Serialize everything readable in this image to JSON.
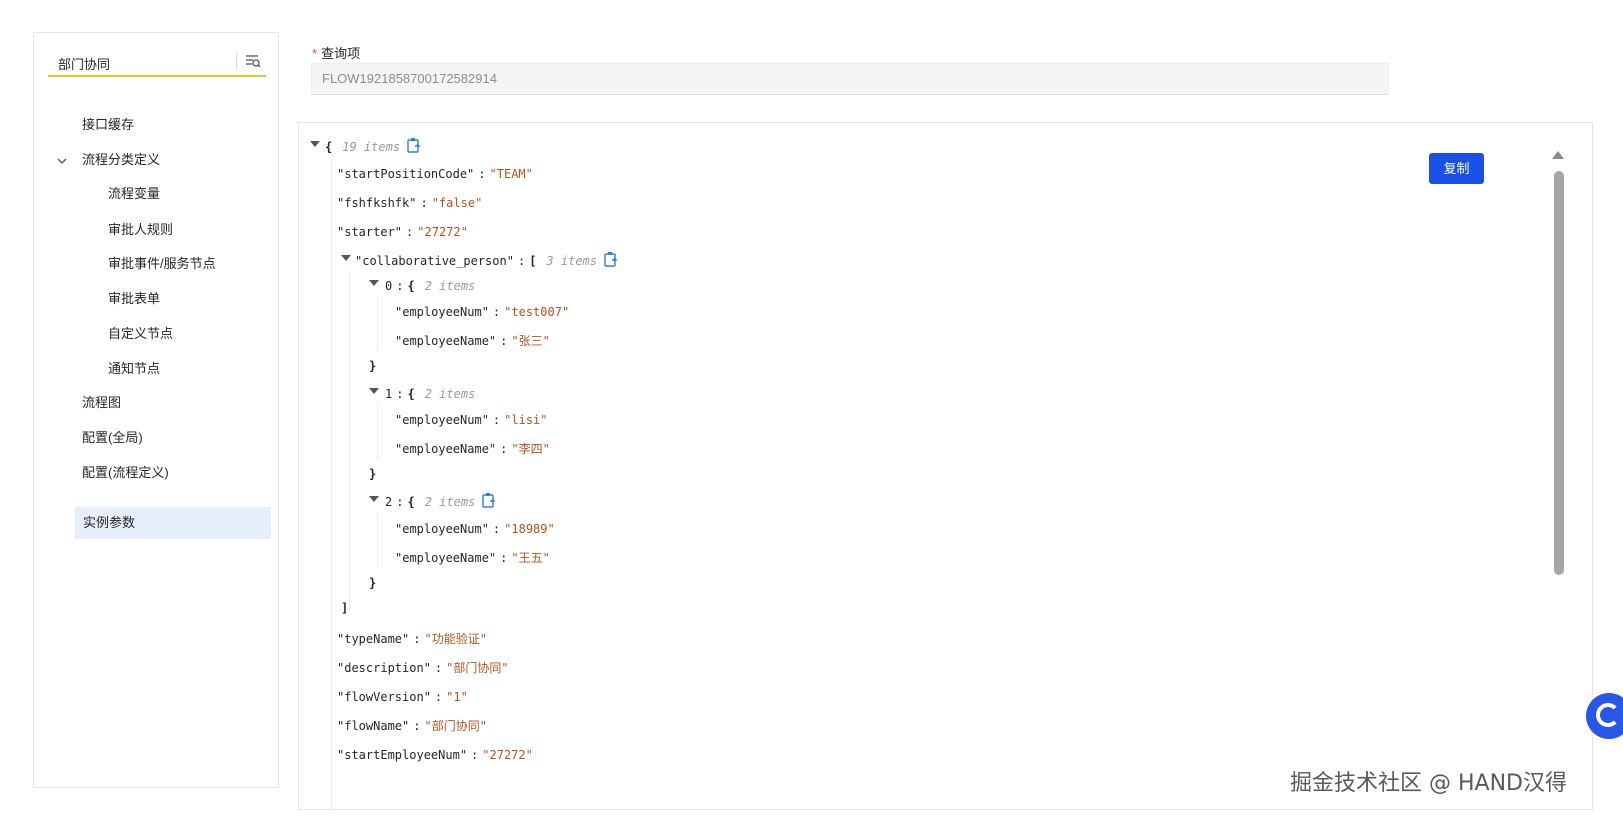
{
  "sidebar": {
    "search_value": "部门协同",
    "items": [
      {
        "label": "接口缓存"
      },
      {
        "label": "流程分类定义"
      },
      {
        "label": "流程变量"
      },
      {
        "label": "审批人规则"
      },
      {
        "label": "审批事件/服务节点"
      },
      {
        "label": "审批表单"
      },
      {
        "label": "自定义节点"
      },
      {
        "label": "通知节点"
      },
      {
        "label": "流程图"
      },
      {
        "label": "配置(全局)"
      },
      {
        "label": "配置(流程定义)"
      },
      {
        "label": "实例参数"
      }
    ],
    "selected": "实例参数"
  },
  "query": {
    "required_mark": "*",
    "label": "查询项",
    "value": "FLOW1921858700172582914"
  },
  "json_view": {
    "copy_label": "复制",
    "root_count": "19 items",
    "rows": [
      {
        "key": "\"startPositionCode\"",
        "value": "\"TEAM\""
      },
      {
        "key": "\"fshfkshfk\"",
        "value": "\"false\""
      },
      {
        "key": "\"starter\"",
        "value": "\"27272\""
      },
      {
        "key": "\"collaborative_person\"",
        "count": "3 items"
      },
      {
        "key": "0",
        "count": "2 items"
      },
      {
        "key": "\"employeeNum\"",
        "value": "\"test007\""
      },
      {
        "key": "\"employeeName\"",
        "value": "\"张三\""
      },
      {
        "key": "1",
        "count": "2 items"
      },
      {
        "key": "\"employeeNum\"",
        "value": "\"lisi\""
      },
      {
        "key": "\"employeeName\"",
        "value": "\"李四\""
      },
      {
        "key": "2",
        "count": "2 items"
      },
      {
        "key": "\"employeeNum\"",
        "value": "\"18989\""
      },
      {
        "key": "\"employeeName\"",
        "value": "\"王五\""
      },
      {
        "key": "\"typeName\"",
        "value": "\"功能验证\""
      },
      {
        "key": "\"description\"",
        "value": "\"部门协同\""
      },
      {
        "key": "\"flowVersion\"",
        "value": "\"1\""
      },
      {
        "key": "\"flowName\"",
        "value": "\"部门协同\""
      },
      {
        "key": "\"startEmployeeNum\"",
        "value": "\"27272\""
      }
    ]
  },
  "watermark": "掘金技术社区 @ HAND汉得",
  "colors": {
    "accent": "#1a4fe8",
    "value_text": "#b5521e",
    "search_underline": "#f0c02e",
    "selected_bg": "#e6eefb"
  },
  "icons": [
    "filter-list-icon",
    "chevron-down-icon",
    "clipboard-icon",
    "scroll-up-icon",
    "assistant-icon"
  ]
}
